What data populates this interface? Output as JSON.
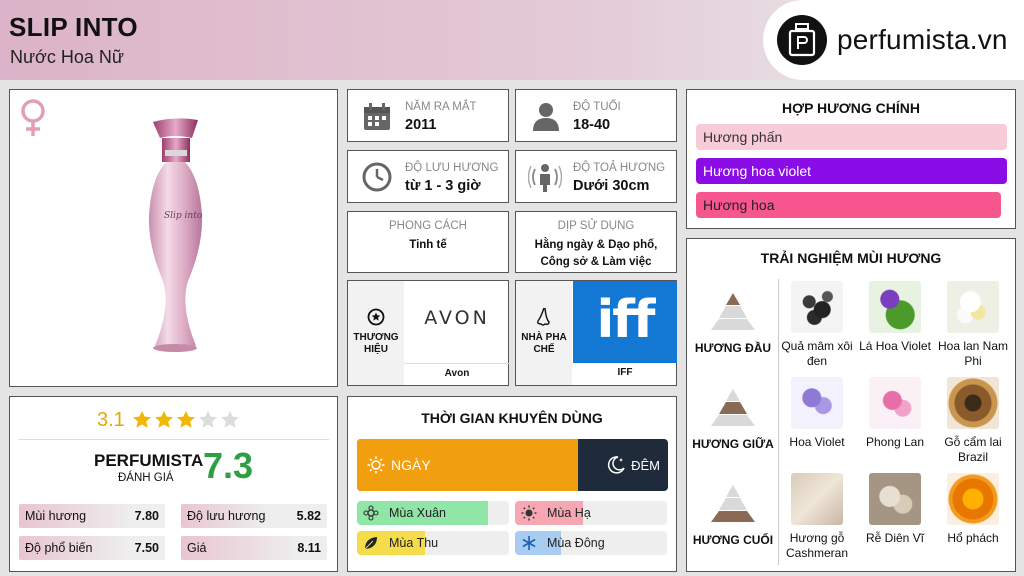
{
  "header": {
    "title": "SLIP INTO",
    "subtitle": "Nước Hoa Nữ"
  },
  "logo": {
    "text": "perfumista.vn"
  },
  "product": {
    "gender_icon": "female-symbol-icon",
    "bottle_script": "Slip into"
  },
  "info": {
    "year_label": "NĂM RA MẮT",
    "year_value": "2011",
    "age_label": "ĐỘ TUỔI",
    "age_value": "18-40",
    "longevity_label": "ĐỘ LƯU HƯƠNG",
    "longevity_value": "từ 1 - 3 giờ",
    "sillage_label": "ĐỘ TOẢ HƯƠNG",
    "sillage_value": "Dưới 30cm",
    "style_label": "PHONG CÁCH",
    "style_value": "Tinh tế",
    "occasion_label": "DỊP SỬ DỤNG",
    "occasion_value": "Hằng ngày & Dạo phố, Công sở & Làm việc",
    "brand_label": "THƯƠNG HIỆU",
    "brand_logo": "AVON",
    "brand_name": "Avon",
    "perfumer_label": "NHÀ PHA CHẾ",
    "perfumer_logo": "iff",
    "perfumer_name": "IFF"
  },
  "accords": {
    "title": "HỢP HƯƠNG CHÍNH",
    "items": [
      {
        "label": "Hương phấn",
        "color": "#f8cbd9",
        "text_color": "#333",
        "level": 1.0
      },
      {
        "label": "Hương hoa violet",
        "color": "#8a0de8",
        "text_color": "#fff",
        "level": 1.0
      },
      {
        "label": "Hương hoa",
        "color": "#f7568f",
        "text_color": "#222",
        "level": 0.98
      }
    ]
  },
  "notes": {
    "title": "TRẢI NGHIỆM MÙI HƯƠNG",
    "top_label": "HƯƠNG ĐẦU",
    "middle_label": "HƯƠNG GIỮA",
    "base_label": "HƯƠNG CUỐI",
    "top": [
      {
        "name": "Quả mâm xôi đen"
      },
      {
        "name": "Lá Hoa Violet"
      },
      {
        "name": "Hoa lan Nam Phi"
      }
    ],
    "middle": [
      {
        "name": "Hoa Violet"
      },
      {
        "name": "Phong Lan"
      },
      {
        "name": "Gỗ cẩm lai Brazil"
      }
    ],
    "base": [
      {
        "name": "Hương gỗ Cashmeran"
      },
      {
        "name": "Rễ Diên Vĩ"
      },
      {
        "name": "Hổ phách"
      }
    ]
  },
  "rating": {
    "stars_value": "3.1",
    "stars": 3.1,
    "brand": "PERFUMISTA",
    "eval_label": "ĐÁNH GIÁ",
    "score": "7.3",
    "metrics": [
      {
        "label": "Mùi hương",
        "value": "7.80"
      },
      {
        "label": "Độ lưu hương",
        "value": "5.82"
      },
      {
        "label": "Độ phổ biến",
        "value": "7.50"
      },
      {
        "label": "Giá",
        "value": "8.11"
      }
    ]
  },
  "time": {
    "title": "THỜI GIAN KHUYÊN DÙNG",
    "day_label": "NGÀY",
    "night_label": "ĐÊM",
    "day_fraction": 0.71,
    "seasons": [
      {
        "label": "Mùa Xuân",
        "level": 0.86,
        "color": "#8fe6a6"
      },
      {
        "label": "Mùa Hạ",
        "level": 0.45,
        "color": "#f7a7b3"
      },
      {
        "label": "Mùa Thu",
        "level": 0.45,
        "color": "#f5dc4a"
      },
      {
        "label": "Mùa Đông",
        "level": 0.3,
        "color": "#a9ccf2"
      }
    ]
  }
}
